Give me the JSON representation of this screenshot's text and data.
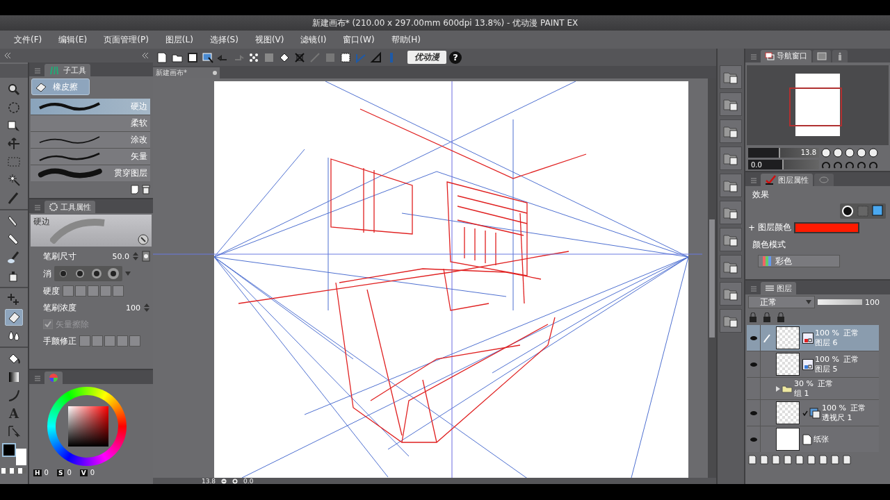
{
  "window": {
    "title": "新建画布* (210.00 x 297.00mm 600dpi 13.8%) - 优动漫 PAINT EX"
  },
  "menu": [
    "文件(F)",
    "编辑(E)",
    "页面管理(P)",
    "图层(L)",
    "选择(S)",
    "视图(V)",
    "滤镜(I)",
    "窗口(W)",
    "帮助(H)"
  ],
  "toolbar": {
    "logo": "优动漫",
    "help": "?"
  },
  "tools": [
    {
      "kind": "zoom",
      "selected": false
    },
    {
      "kind": "rotate",
      "selected": false
    },
    {
      "kind": "object",
      "selected": false
    },
    {
      "kind": "move",
      "selected": false
    },
    {
      "kind": "select",
      "selected": false
    },
    {
      "kind": "wand",
      "selected": false
    },
    {
      "kind": "dropper",
      "selected": false
    },
    {
      "kind": "pen",
      "selected": false
    },
    {
      "kind": "marker",
      "selected": false
    },
    {
      "kind": "brush",
      "selected": false
    },
    {
      "kind": "spray",
      "selected": false
    },
    {
      "kind": "deco",
      "selected": false
    },
    {
      "kind": "eraser",
      "selected": true
    },
    {
      "kind": "blend",
      "selected": false
    },
    {
      "kind": "fill",
      "selected": false
    },
    {
      "kind": "gradient",
      "selected": false
    },
    {
      "kind": "curve",
      "selected": false
    },
    {
      "kind": "text",
      "glyph": "A",
      "selected": false
    },
    {
      "kind": "balloon",
      "selected": false
    }
  ],
  "subtool_panel": {
    "tab": "子工具",
    "group": "橡皮擦",
    "subtools": [
      {
        "label": "硬边",
        "kind": "hard",
        "selected": true
      },
      {
        "label": "柔软",
        "kind": "soft",
        "selected": false
      },
      {
        "label": "涂改",
        "kind": "thin",
        "selected": false
      },
      {
        "label": "矢量",
        "kind": "dotted",
        "selected": false
      },
      {
        "label": "贯穿图层",
        "kind": "thick",
        "selected": false
      }
    ]
  },
  "tool_property": {
    "tab": "工具属性",
    "preview_label": "硬边",
    "brush_size": {
      "label": "笔刷尺寸",
      "value": "50.0"
    },
    "antialias": {
      "label": "消"
    },
    "hardness": {
      "label": "硬度"
    },
    "density": {
      "label": "笔刷浓度",
      "value": "100"
    },
    "vector_erase": {
      "label": "矢量擦除",
      "checked": true,
      "disabled": true
    },
    "stabilization": {
      "label": "手颤修正"
    }
  },
  "color_panel": {
    "h_label": "H",
    "h_value": "0",
    "s_label": "S",
    "s_value": "0",
    "v_label": "V",
    "v_value": "0"
  },
  "canvas": {
    "tab": "新建画布*",
    "zoom": "13.8",
    "angle": "0.0"
  },
  "navigator": {
    "tab": "导航窗口",
    "zoom": "13.8",
    "zoom_slider": {
      "level": 0.45
    },
    "angle": "0.0",
    "angle_slider": {
      "level": 0.5
    }
  },
  "layer_property": {
    "tab": "图层属性",
    "effect_label": "效果",
    "layer_color_label": "图层颜色",
    "layer_color_swatch": {
      "color": "#ff1a00"
    },
    "plus": "+",
    "color_mode_label": "颜色模式",
    "color_mode": "彩色"
  },
  "layers_panel": {
    "tab": "图层",
    "blend": "正常",
    "opacity": "100",
    "opacity_slider": {
      "level": 1
    },
    "layers": [
      {
        "kind": "raster",
        "opacity": "100 %",
        "blend": "正常",
        "name": "图层 6",
        "color": "#e02020",
        "visible": true,
        "selected": true
      },
      {
        "kind": "raster",
        "opacity": "100 %",
        "blend": "正常",
        "name": "图层 5",
        "color": "#3a7ad8",
        "visible": true,
        "selected": false
      },
      {
        "kind": "folder",
        "opacity": "30 %",
        "blend": "正常",
        "name": "组 1",
        "visible": false,
        "selected": false
      },
      {
        "kind": "ruler",
        "opacity": "100 %",
        "blend": "正常",
        "name": "透视尺 1",
        "visible": true,
        "selected": false
      },
      {
        "kind": "paper",
        "name": "纸张",
        "visible": true,
        "selected": false
      }
    ]
  }
}
